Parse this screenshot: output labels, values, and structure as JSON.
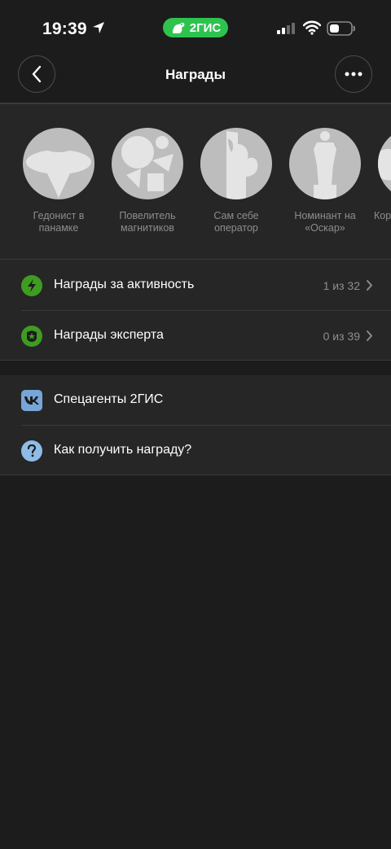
{
  "status": {
    "time": "19:39",
    "brand": "2ГИС"
  },
  "nav": {
    "title": "Награды",
    "back_icon": "chevron-left-icon",
    "more_icon": "ellipsis-icon"
  },
  "awards": [
    {
      "label": "Гедонист в панамке",
      "icon": "panama-hat-badge"
    },
    {
      "label": "Повелитель магнитиков",
      "icon": "magnets-badge"
    },
    {
      "label": "Сам себе оператор",
      "icon": "camera-operator-badge"
    },
    {
      "label": "Номинант на «Оскар»",
      "icon": "oscar-statue-badge"
    },
    {
      "label": "Кор",
      "icon": "partial-badge"
    }
  ],
  "rows": {
    "activity": {
      "label": "Награды за активность",
      "count": "1 из 32",
      "icon": "lightning-icon",
      "icon_color": "#3e9d21"
    },
    "expert": {
      "label": "Награды эксперта",
      "count": "0 из 39",
      "icon": "shield-star-icon",
      "icon_color": "#3e9d21"
    },
    "agents": {
      "label": "Спецагенты 2ГИС",
      "icon": "vk-icon",
      "icon_color": "#76a6d8"
    },
    "howto": {
      "label": "Как получить награду?",
      "icon": "question-icon",
      "icon_color": "#8fbbe8"
    }
  },
  "colors": {
    "background": "#1c1c1c",
    "panel": "#262626",
    "brand_green": "#2ec24f"
  }
}
